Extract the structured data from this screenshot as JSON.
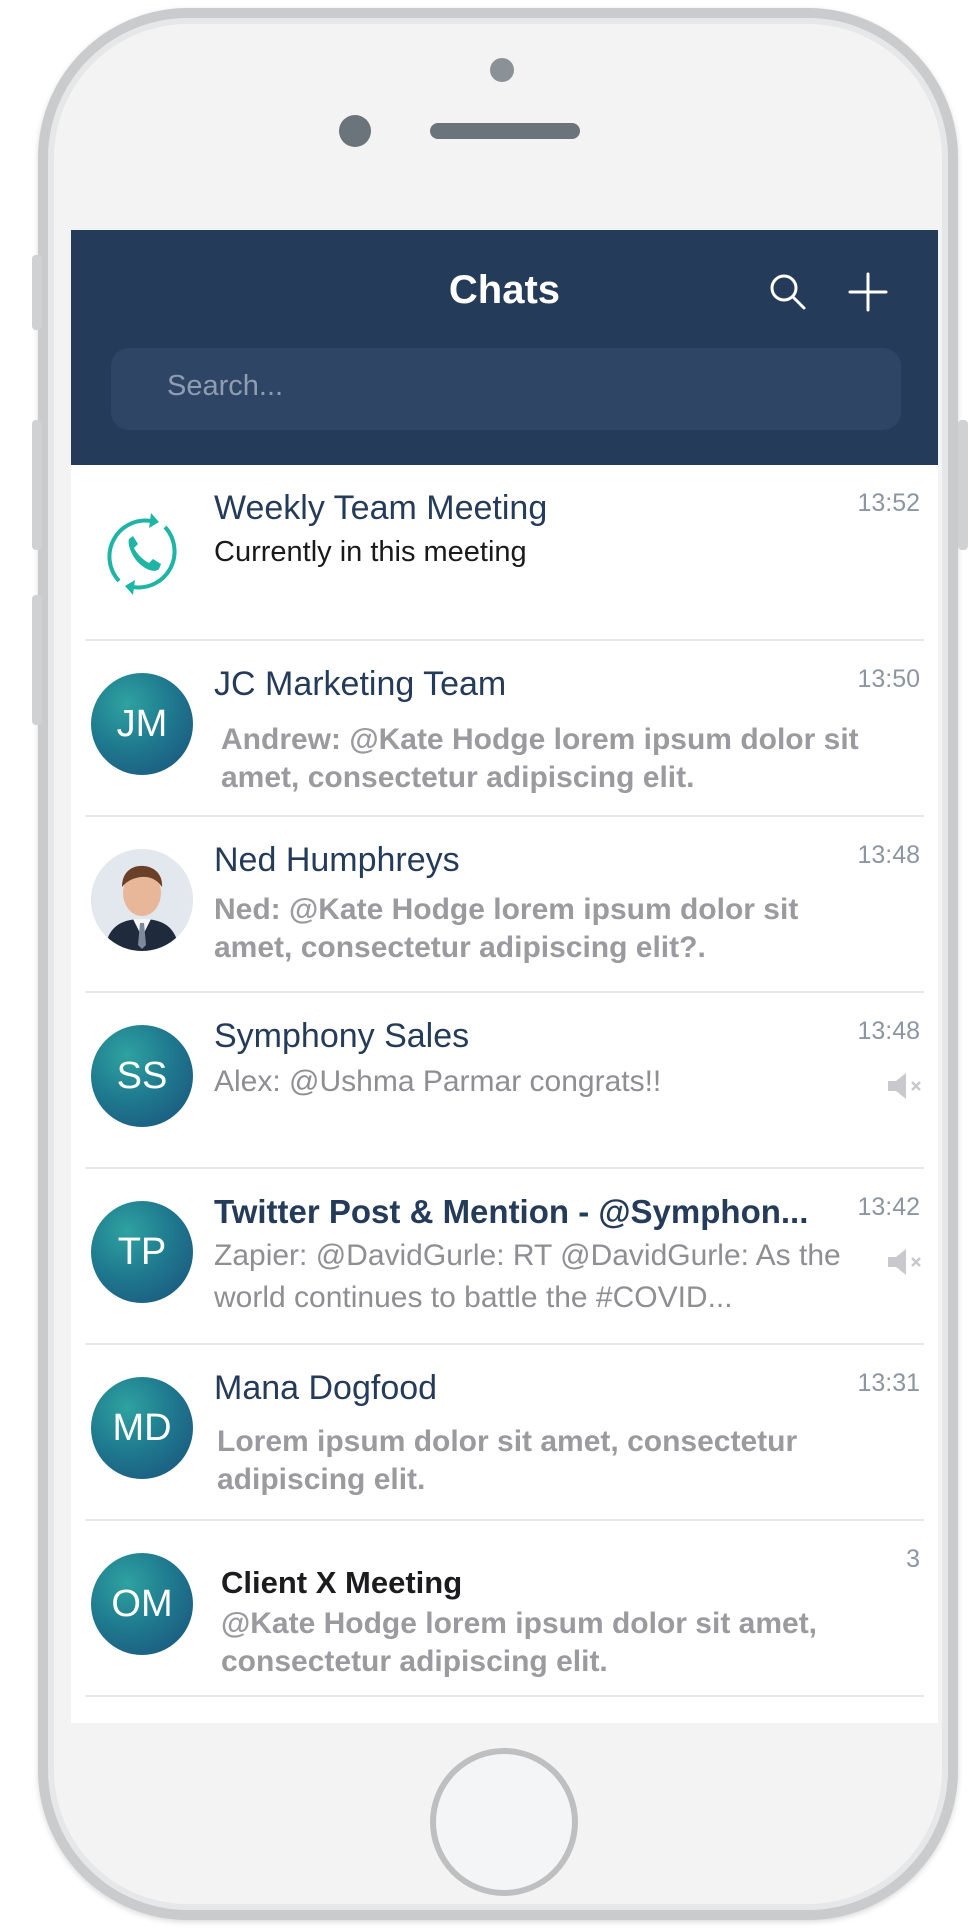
{
  "header": {
    "title": "Chats",
    "search_icon": "search-icon",
    "add_icon": "plus-icon",
    "search_placeholder": "Search..."
  },
  "colors": {
    "header_bg": "#253b5a",
    "accent_teal": "#1fb5a6",
    "name_text": "#253b5a"
  },
  "chats": [
    {
      "name": "Weekly Team Meeting",
      "time": "13:52",
      "preview": "Currently in this meeting",
      "avatar_icon": "phone-call-icon"
    },
    {
      "name": "JC Marketing Team",
      "time": "13:50",
      "preview": "Andrew: @Kate Hodge lorem ipsum dolor sit amet, consectetur adipiscing elit.",
      "avatar_initials": "JM"
    },
    {
      "name": "Ned Humphreys",
      "time": "13:48",
      "preview": "Ned: @Kate Hodge lorem ipsum dolor sit amet, consectetur adipiscing elit?.",
      "avatar_icon": "person-photo"
    },
    {
      "name": "Symphony Sales",
      "time": "13:48",
      "preview": "Alex: @Ushma Parmar congrats!!",
      "avatar_initials": "SS",
      "muted_icon": "muted-speaker-icon"
    },
    {
      "name": "Twitter Post & Mention - @Symphon...",
      "time": "13:42",
      "preview": "Zapier: @DavidGurle: RT @DavidGurle: As the world continues to battle the #COVID...",
      "avatar_initials": "TP",
      "muted_icon": "muted-speaker-icon"
    },
    {
      "name": "Mana Dogfood",
      "time": "13:31",
      "preview": "Lorem ipsum dolor sit amet, consectetur adipiscing elit.",
      "avatar_initials": "MD"
    },
    {
      "name": "Client X Meeting",
      "time": "3",
      "preview": "@Kate Hodge lorem ipsum dolor sit amet, consectetur adipiscing elit.",
      "avatar_initials": "OM"
    }
  ]
}
